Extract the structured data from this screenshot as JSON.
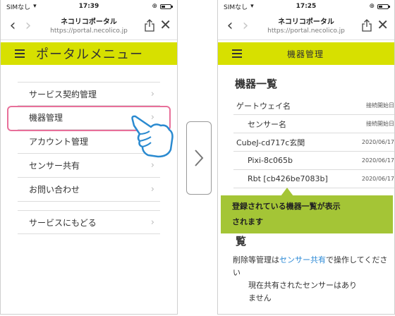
{
  "left": {
    "status": {
      "carrier": "SIMなし",
      "time": "17:39"
    },
    "browser": {
      "site": "ネコリコポータル",
      "url": "https://portal.necolico.jp"
    },
    "header_title": "ポータルメニュー",
    "menu": [
      {
        "label": "サービス契約管理"
      },
      {
        "label": "機器管理"
      },
      {
        "label": "アカウント管理"
      },
      {
        "label": "センサー共有"
      },
      {
        "label": "お問い合わせ"
      }
    ],
    "back_item": "サービスにもどる"
  },
  "right": {
    "status": {
      "carrier": "SIMなし",
      "time": "17:25"
    },
    "browser": {
      "site": "ネコリコポータル",
      "url": "https://portal.necolico.jp"
    },
    "header_title": "機器管理",
    "section_title": "機器一覧",
    "devices": [
      {
        "name": "ゲートウェイ名",
        "date": "接続開始日",
        "indent": false
      },
      {
        "name": "センサー名",
        "date": "接続開始日",
        "indent": true
      },
      {
        "name": "CubeJ-cd717c玄関",
        "date": "2020/06/17",
        "indent": false
      },
      {
        "name": "Pixi-8c065b",
        "date": "2020/06/17",
        "indent": true
      },
      {
        "name": "Rbt [cb426be7083b]",
        "date": "2020/06/17",
        "indent": true
      }
    ],
    "callout_line1": "登録されている機器一覧が表示",
    "callout_line2": "されます",
    "section2_title_partial": "覧",
    "note_prefix": "削除等管理は",
    "note_link": "センサー共有",
    "note_suffix": "で操作してください",
    "no_shared_line1": "現在共有されたセンサーはあり",
    "no_shared_line2": "ません"
  },
  "colors": {
    "header": "#d7e000",
    "callout": "#a4c536",
    "highlight": "#e8709a",
    "link": "#2d8ad6"
  }
}
